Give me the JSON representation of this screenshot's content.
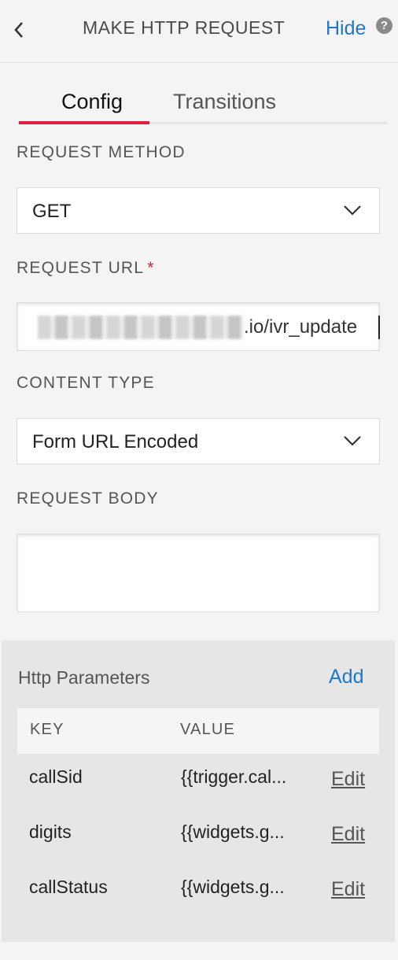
{
  "header": {
    "title": "MAKE HTTP REQUEST",
    "hide_label": "Hide",
    "help_glyph": "?"
  },
  "tabs": [
    {
      "label": "Config",
      "active": true
    },
    {
      "label": "Transitions",
      "active": false
    }
  ],
  "request_method": {
    "label": "REQUEST METHOD",
    "value": "GET"
  },
  "request_url": {
    "label": "REQUEST URL",
    "required_marker": "*",
    "visible_value": ".io/ivr_update"
  },
  "content_type": {
    "label": "CONTENT TYPE",
    "value": "Form URL Encoded"
  },
  "request_body": {
    "label": "REQUEST BODY",
    "value": ""
  },
  "http_parameters": {
    "title": "Http Parameters",
    "add_label": "Add",
    "columns": [
      "KEY",
      "VALUE"
    ],
    "rows": [
      {
        "key": "callSid",
        "value": "{{trigger.cal...",
        "edit": "Edit"
      },
      {
        "key": "digits",
        "value": "{{widgets.g...",
        "edit": "Edit"
      },
      {
        "key": "callStatus",
        "value": "{{widgets.g...",
        "edit": "Edit"
      }
    ]
  },
  "colors": {
    "accent_red": "#e01d3a",
    "link_blue": "#1f78c8",
    "background": "#f4f4f4"
  },
  "icons": {
    "back": "chevron-left-icon",
    "help": "question-circle-icon",
    "dropdown": "chevron-down-icon"
  }
}
